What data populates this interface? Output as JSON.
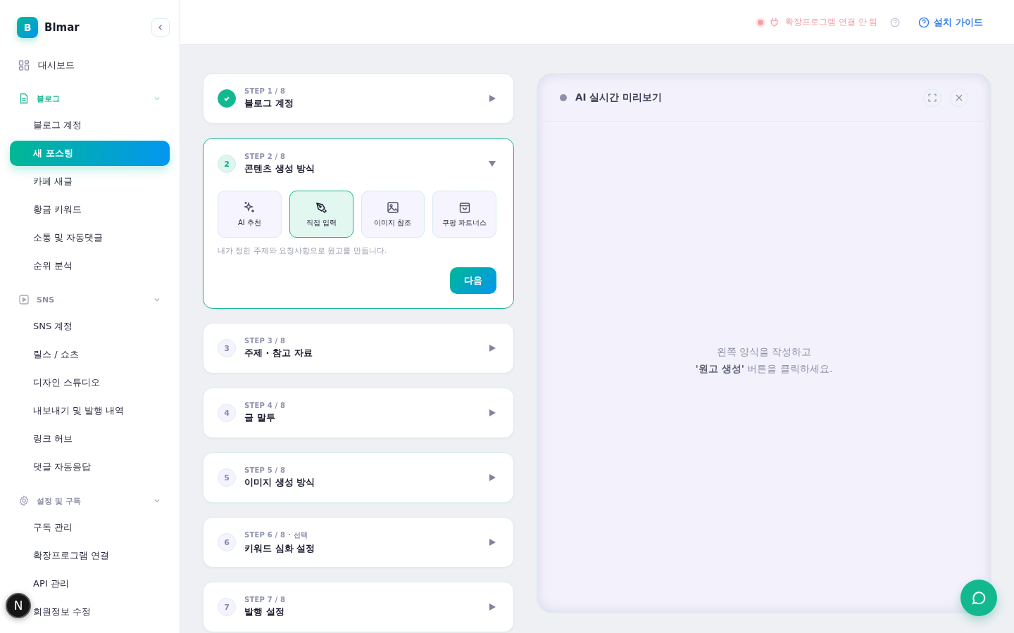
{
  "brand": {
    "logo_letter": "B",
    "name": "Blmar"
  },
  "sidebar": {
    "top_item": {
      "label": "대시보드",
      "selected": false
    },
    "sections": [
      {
        "label": "블로그",
        "kind": "document",
        "active": true,
        "expanded": true,
        "items": [
          {
            "label": "블로그 계정",
            "selected": false
          },
          {
            "label": "새 포스팅",
            "selected": true
          },
          {
            "label": "카페 새글",
            "selected": false
          },
          {
            "label": "황금 키워드",
            "selected": false
          },
          {
            "label": "소통 및 자동댓글",
            "selected": false
          },
          {
            "label": "순위 분석",
            "selected": false
          }
        ]
      },
      {
        "label": "SNS",
        "kind": "play",
        "active": false,
        "expanded": true,
        "items": [
          {
            "label": "SNS 계정",
            "selected": false
          },
          {
            "label": "릴스 / 쇼츠",
            "selected": false
          },
          {
            "label": "디자인 스튜디오",
            "selected": false
          },
          {
            "label": "내보내기 및 발행 내역",
            "selected": false
          },
          {
            "label": "링크 허브",
            "selected": false
          },
          {
            "label": "댓글 자동응답",
            "selected": false
          }
        ]
      },
      {
        "label": "설정 및 구독",
        "kind": "gear",
        "active": false,
        "expanded": true,
        "items": [
          {
            "label": "구독 관리",
            "selected": false
          },
          {
            "label": "확장프로그램 연결",
            "selected": false
          },
          {
            "label": "API 관리",
            "selected": false
          },
          {
            "label": "회원정보 수정",
            "selected": false
          }
        ]
      }
    ]
  },
  "floating_badge": {
    "letter": "N"
  },
  "topbar": {
    "extension_status": {
      "label": "확장프로그램 연결 안 됨",
      "connected": false
    },
    "guide_link": "설치 가이드"
  },
  "steps": [
    {
      "step": "STEP 1 / 8",
      "title": "블로그 계정",
      "done": true,
      "expanded": false
    },
    {
      "step": "STEP 2 / 8",
      "title": "콘텐츠 생성 방식",
      "marker": "2",
      "done": false,
      "expanded": true,
      "options": [
        {
          "label": "AI 추천",
          "kind": "sparkle",
          "selected": false
        },
        {
          "label": "직접 입력",
          "kind": "pen",
          "selected": true
        },
        {
          "label": "이미지 참조",
          "kind": "image",
          "selected": false
        },
        {
          "label": "쿠팡 파트너스",
          "kind": "bag",
          "selected": false
        }
      ],
      "hint": "내가 정한 주제와 요청사항으로 원고를 만듭니다.",
      "next_button": "다음"
    },
    {
      "step": "STEP 3 / 8",
      "title": "주제 · 참고 자료",
      "marker": "3",
      "done": false,
      "expanded": false
    },
    {
      "step": "STEP 4 / 8",
      "title": "글 말투",
      "marker": "4",
      "done": false,
      "expanded": false
    },
    {
      "step": "STEP 5 / 8",
      "title": "이미지 생성 방식",
      "marker": "5",
      "done": false,
      "expanded": false
    },
    {
      "step": "STEP 6 / 8 · 선택",
      "title": "키워드 심화 설정",
      "marker": "6",
      "done": false,
      "expanded": false
    },
    {
      "step": "STEP 7 / 8",
      "title": "발행 설정",
      "marker": "7",
      "done": false,
      "expanded": false
    }
  ],
  "preview": {
    "title": "AI 실시간 미리보기",
    "message": "왼쪽 양식을 작성하고\n**'원고 생성'** 버튼을 클릭하세요."
  }
}
